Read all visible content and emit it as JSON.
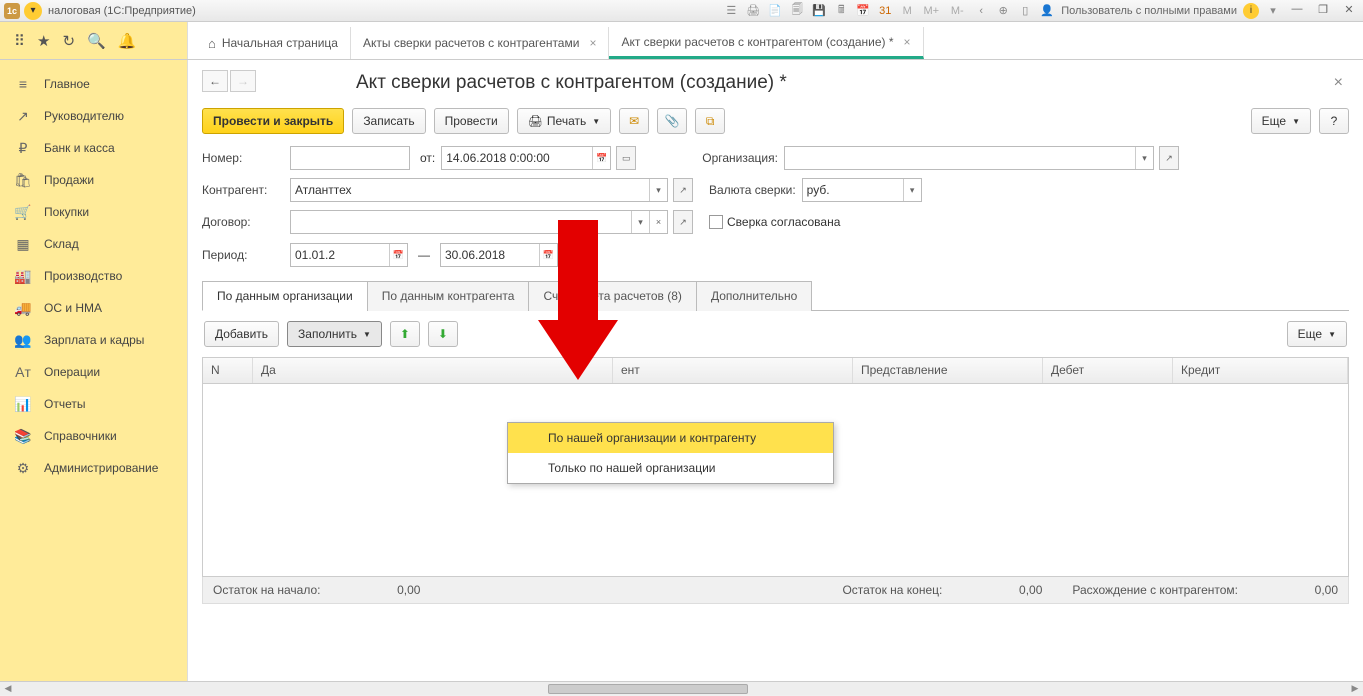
{
  "titlebar": {
    "app_title": "налоговая  (1С:Предприятие)",
    "user_label": "Пользователь с полными правами",
    "m_labels": [
      "M",
      "M+",
      "M-"
    ]
  },
  "top_tabs": [
    {
      "label": "Начальная страница",
      "home": true
    },
    {
      "label": "Акты сверки расчетов с контрагентами",
      "closable": true
    },
    {
      "label": "Акт сверки расчетов с контрагентом (создание) *",
      "closable": true,
      "active": true
    }
  ],
  "sidebar": [
    {
      "icon": "≡",
      "label": "Главное"
    },
    {
      "icon": "↗",
      "label": "Руководителю"
    },
    {
      "icon": "₽",
      "label": "Банк и касса"
    },
    {
      "icon": "🛍",
      "label": "Продажи"
    },
    {
      "icon": "🛒",
      "label": "Покупки"
    },
    {
      "icon": "▦",
      "label": "Склад"
    },
    {
      "icon": "🏭",
      "label": "Производство"
    },
    {
      "icon": "🚚",
      "label": "ОС и НМА"
    },
    {
      "icon": "👥",
      "label": "Зарплата и кадры"
    },
    {
      "icon": "Aᴛ",
      "label": "Операции"
    },
    {
      "icon": "📊",
      "label": "Отчеты"
    },
    {
      "icon": "📚",
      "label": "Справочники"
    },
    {
      "icon": "⚙",
      "label": "Администрирование"
    }
  ],
  "page": {
    "title": "Акт сверки расчетов с контрагентом (создание) *"
  },
  "toolbar": {
    "submit_close": "Провести и закрыть",
    "save": "Записать",
    "submit": "Провести",
    "print": "Печать",
    "more": "Еще",
    "help": "?"
  },
  "form": {
    "number_label": "Номер:",
    "number_value": "",
    "date_from_label": "от:",
    "date_value": "14.06.2018  0:00:00",
    "org_label": "Организация:",
    "org_value": "",
    "counterparty_label": "Контрагент:",
    "counterparty_value": "Атланттех",
    "currency_label": "Валюта сверки:",
    "currency_value": "руб.",
    "contract_label": "Договор:",
    "contract_value": "",
    "agreed_label": "Сверка согласована",
    "period_label": "Период:",
    "period_from": "01.01.2",
    "period_sep": "—",
    "period_to": "30.06.2018",
    "period_more": "..."
  },
  "doc_tabs": [
    "По данным организации",
    "По данным контрагента",
    "Счета учета расчетов (8)",
    "Дополнительно"
  ],
  "tbl_toolbar": {
    "add": "Добавить",
    "fill": "Заполнить",
    "more": "Еще"
  },
  "fill_menu": [
    "По нашей организации и контрагенту",
    "Только по нашей организации"
  ],
  "table_headers": {
    "n": "N",
    "date": "Да",
    "doc": "ент",
    "repr": "Представление",
    "debit": "Дебет",
    "credit": "Кредит"
  },
  "footer": {
    "start_label": "Остаток на начало:",
    "start_value": "0,00",
    "end_label": "Остаток на конец:",
    "end_value": "0,00",
    "diff_label": "Расхождение с контрагентом:",
    "diff_value": "0,00"
  }
}
